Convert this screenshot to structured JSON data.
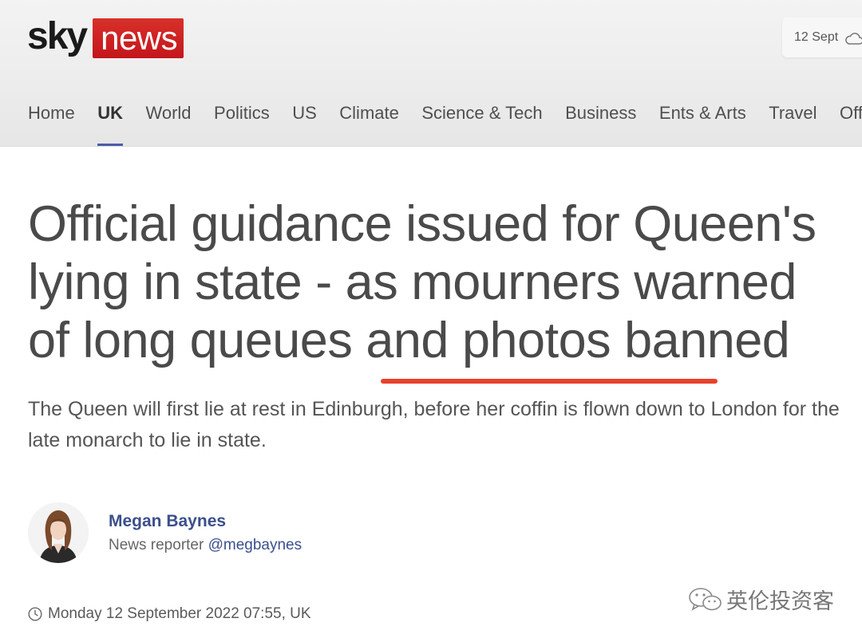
{
  "header": {
    "logo": {
      "sky": "sky",
      "news": "news",
      "brand_red": "#c4161c"
    },
    "date": "12 Sept",
    "weather_icon": "cloud-icon"
  },
  "nav": {
    "items": [
      {
        "label": "Home",
        "active": false
      },
      {
        "label": "UK",
        "active": true
      },
      {
        "label": "World",
        "active": false
      },
      {
        "label": "Politics",
        "active": false
      },
      {
        "label": "US",
        "active": false
      },
      {
        "label": "Climate",
        "active": false
      },
      {
        "label": "Science & Tech",
        "active": false
      },
      {
        "label": "Business",
        "active": false
      },
      {
        "label": "Ents & Arts",
        "active": false
      },
      {
        "label": "Travel",
        "active": false
      },
      {
        "label": "Offb",
        "active": false
      }
    ],
    "active_color": "#4a5da8"
  },
  "article": {
    "headline": "Official guidance issued for Queen's lying in state - as mourners warned of long queues and photos banned",
    "highlight_color": "#e8412c",
    "standfirst": "The Queen will first lie at rest in Edinburgh, before her coffin is flown down to London for the late monarch to lie in state."
  },
  "author": {
    "name": "Megan Baynes",
    "role": "News reporter",
    "handle": "@megbaynes",
    "link_color": "#3b4f8c"
  },
  "timestamp": {
    "icon": "clock-icon",
    "text": "Monday 12 September 2022 07:55, UK"
  },
  "watermark": {
    "icon": "wechat-icon",
    "text": "英伦投资客"
  }
}
